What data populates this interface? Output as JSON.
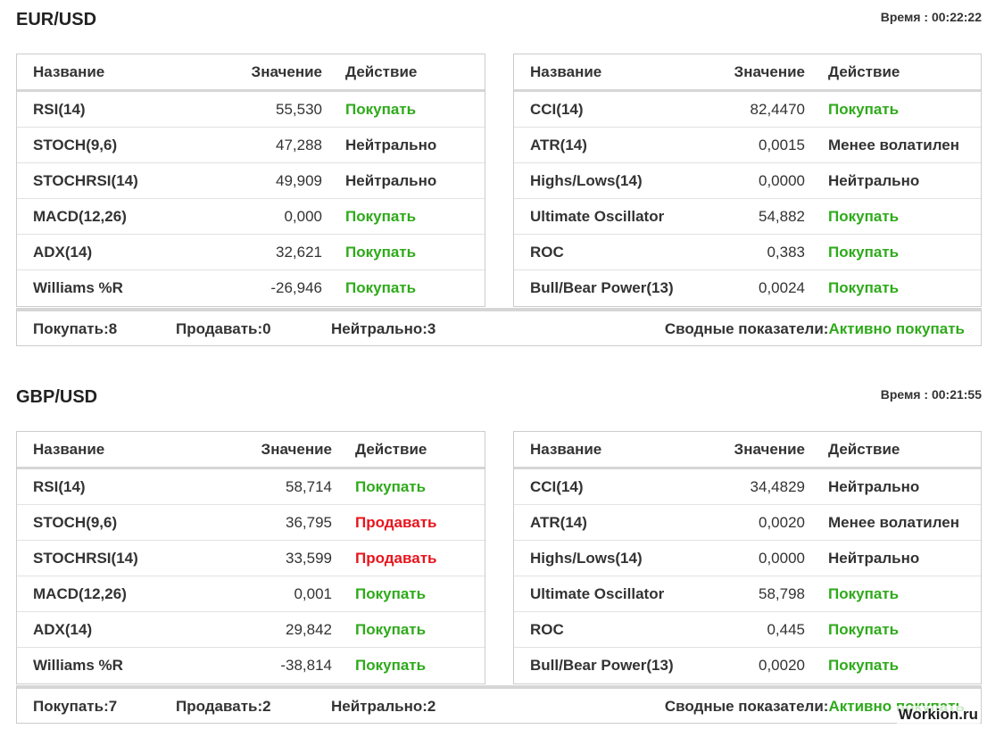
{
  "colors": {
    "buy": "#2eaa1a",
    "sell": "#e8141c",
    "neutral": "#333333",
    "border": "#cccccc"
  },
  "columns": {
    "name": "Название",
    "value": "Значение",
    "action": "Действие"
  },
  "sections": [
    {
      "pair": "EUR/USD",
      "time_label": "Время : ",
      "time": "00:22:22",
      "left_rows": [
        {
          "name": "RSI(14)",
          "value": "55,530",
          "action": "Покупать",
          "kind": "buy"
        },
        {
          "name": "STOCH(9,6)",
          "value": "47,288",
          "action": "Нейтрально",
          "kind": "neutral"
        },
        {
          "name": "STOCHRSI(14)",
          "value": "49,909",
          "action": "Нейтрально",
          "kind": "neutral"
        },
        {
          "name": "MACD(12,26)",
          "value": "0,000",
          "action": "Покупать",
          "kind": "buy"
        },
        {
          "name": "ADX(14)",
          "value": "32,621",
          "action": "Покупать",
          "kind": "buy"
        },
        {
          "name": "Williams %R",
          "value": "-26,946",
          "action": "Покупать",
          "kind": "buy"
        }
      ],
      "right_rows": [
        {
          "name": "CCI(14)",
          "value": "82,4470",
          "action": "Покупать",
          "kind": "buy"
        },
        {
          "name": "ATR(14)",
          "value": "0,0015",
          "action": "Менее волатилен",
          "kind": "neutral"
        },
        {
          "name": "Highs/Lows(14)",
          "value": "0,0000",
          "action": "Нейтрально",
          "kind": "neutral"
        },
        {
          "name": "Ultimate Oscillator",
          "value": "54,882",
          "action": "Покупать",
          "kind": "buy"
        },
        {
          "name": "ROC",
          "value": "0,383",
          "action": "Покупать",
          "kind": "buy"
        },
        {
          "name": "Bull/Bear Power(13)",
          "value": "0,0024",
          "action": "Покупать",
          "kind": "buy"
        }
      ],
      "summary": {
        "buy": "Покупать:8",
        "sell": "Продавать:0",
        "neutral": "Нейтрально:3",
        "overall_label": "Сводные показатели:",
        "overall_value": "Активно покупать"
      }
    },
    {
      "pair": "GBP/USD",
      "time_label": "Время : ",
      "time": "00:21:55",
      "left_rows": [
        {
          "name": "RSI(14)",
          "value": "58,714",
          "action": "Покупать",
          "kind": "buy"
        },
        {
          "name": "STOCH(9,6)",
          "value": "36,795",
          "action": "Продавать",
          "kind": "sell"
        },
        {
          "name": "STOCHRSI(14)",
          "value": "33,599",
          "action": "Продавать",
          "kind": "sell"
        },
        {
          "name": "MACD(12,26)",
          "value": "0,001",
          "action": "Покупать",
          "kind": "buy"
        },
        {
          "name": "ADX(14)",
          "value": "29,842",
          "action": "Покупать",
          "kind": "buy"
        },
        {
          "name": "Williams %R",
          "value": "-38,814",
          "action": "Покупать",
          "kind": "buy"
        }
      ],
      "right_rows": [
        {
          "name": "CCI(14)",
          "value": "34,4829",
          "action": "Нейтрально",
          "kind": "neutral"
        },
        {
          "name": "ATR(14)",
          "value": "0,0020",
          "action": "Менее волатилен",
          "kind": "neutral"
        },
        {
          "name": "Highs/Lows(14)",
          "value": "0,0000",
          "action": "Нейтрально",
          "kind": "neutral"
        },
        {
          "name": "Ultimate Oscillator",
          "value": "58,798",
          "action": "Покупать",
          "kind": "buy"
        },
        {
          "name": "ROC",
          "value": "0,445",
          "action": "Покупать",
          "kind": "buy"
        },
        {
          "name": "Bull/Bear Power(13)",
          "value": "0,0020",
          "action": "Покупать",
          "kind": "buy"
        }
      ],
      "summary": {
        "buy": "Покупать:7",
        "sell": "Продавать:2",
        "neutral": "Нейтрально:2",
        "overall_label": "Сводные показатели:",
        "overall_value": "Активно покупать"
      }
    }
  ],
  "watermark": "Workion.ru"
}
